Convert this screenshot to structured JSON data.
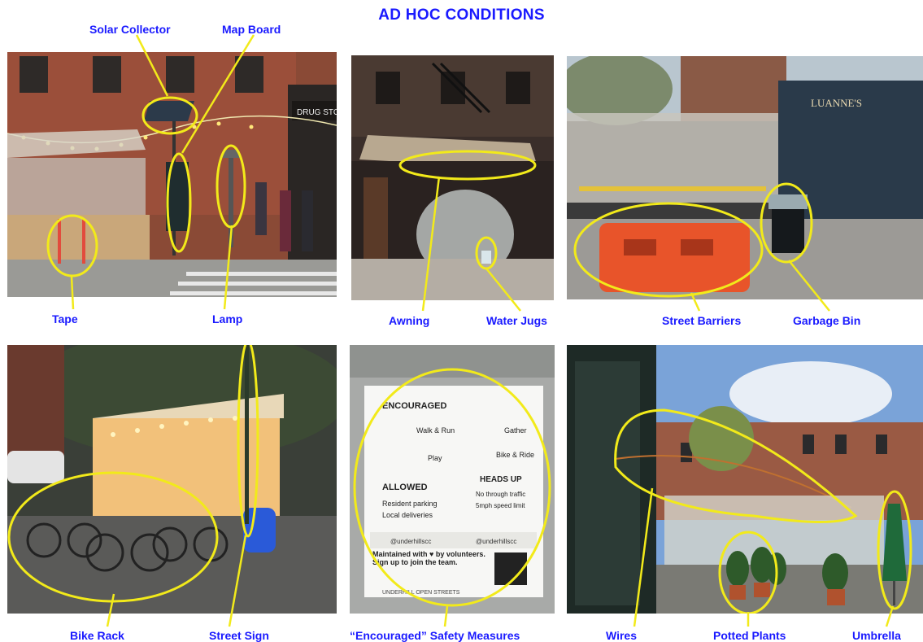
{
  "title": "AD HOC CONDITIONS",
  "labels": {
    "solar_collector": "Solar Collector",
    "map_board": "Map Board",
    "tape": "Tape",
    "lamp": "Lamp",
    "awning": "Awning",
    "water_jugs": "Water Jugs",
    "street_barriers": "Street Barriers",
    "garbage_bin": "Garbage Bin",
    "bike_rack": "Bike Rack",
    "street_sign": "Street Sign",
    "encouraged_safety": "“Encouraged” Safety Measures",
    "wires": "Wires",
    "potted_plants": "Potted Plants",
    "umbrella": "Umbrella"
  },
  "photo_text": {
    "drug_store": "DRUG STORE",
    "luanne": "LUANNE'S",
    "sign": {
      "encouraged": "ENCOURAGED",
      "walk_run": "Walk & Run",
      "gather": "Gather",
      "play": "Play",
      "bike_ride": "Bike & Ride",
      "allowed": "ALLOWED",
      "heads_up": "HEADS UP",
      "resident_parking": "Resident parking",
      "local_deliveries": "Local deliveries",
      "no_through": "No through traffic",
      "speed": "5mph speed limit",
      "handle1": "@underhillscc",
      "handle2": "@underhillscc",
      "maintained": "Maintained with ♥ by volunteers. Sign up to join the team.",
      "footer": "UNDERHILL OPEN STREETS"
    }
  },
  "colors": {
    "label_blue": "#1a1aff",
    "highlight_yellow": "#f2ea1a"
  }
}
